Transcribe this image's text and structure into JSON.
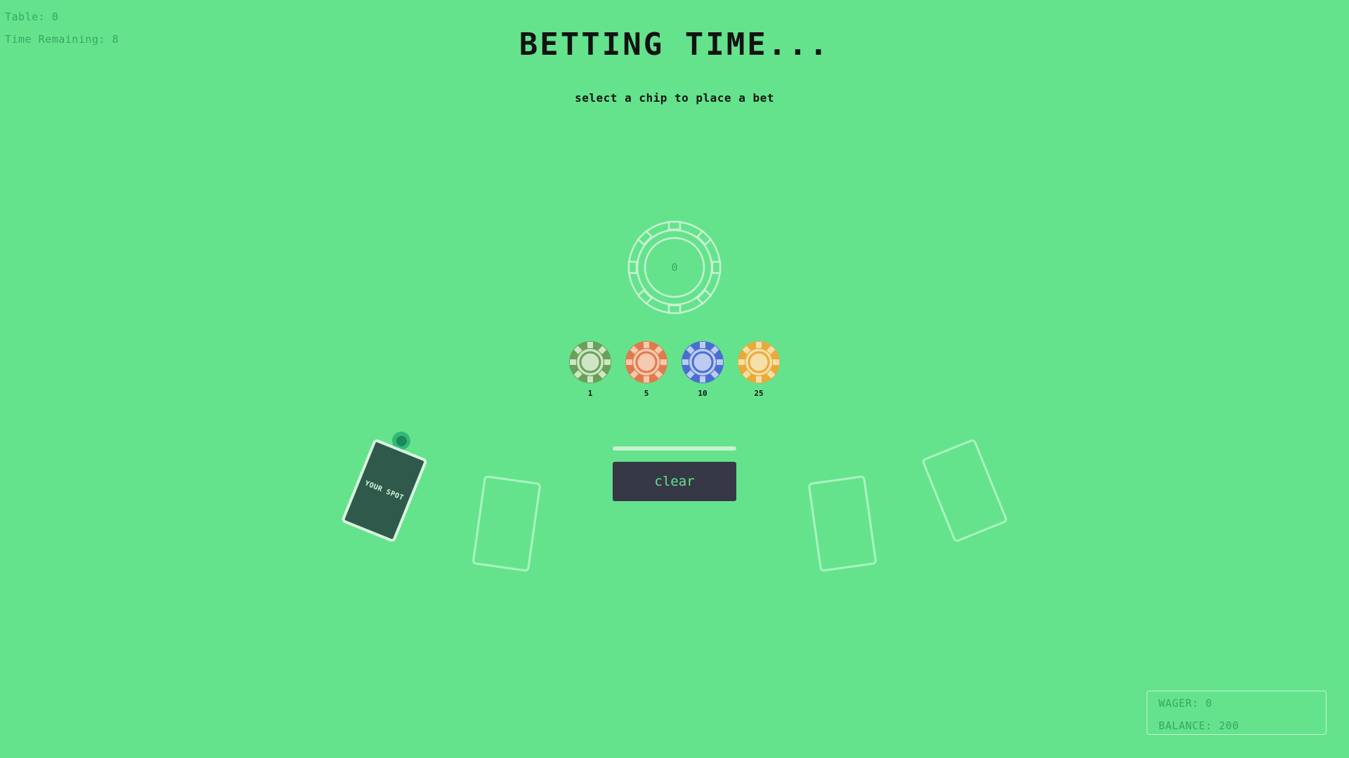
{
  "hud": {
    "table": "Table: 0",
    "time_remaining": "Time Remaining: 8"
  },
  "header": {
    "title": "BETTING TIME...",
    "subtitle": "select a chip to place a bet"
  },
  "bet": {
    "amount": "0"
  },
  "chips": [
    {
      "label": "1",
      "color": "#6aa05a",
      "light": "#cfe6c4",
      "icon": "green-chip-icon"
    },
    {
      "label": "5",
      "color": "#e07a4a",
      "light": "#f6c9b0",
      "icon": "orange-chip-icon"
    },
    {
      "label": "10",
      "color": "#4a6fd0",
      "light": "#bccbf2",
      "icon": "blue-chip-icon"
    },
    {
      "label": "25",
      "color": "#e8aa3a",
      "light": "#f7dfa8",
      "icon": "gold-chip-icon"
    }
  ],
  "seats": {
    "your_spot": "YOUR SPOT"
  },
  "controls": {
    "clear_label": "clear"
  },
  "wallet": {
    "wager": "WAGER: 0",
    "balance": "BALANCE: 200"
  },
  "colors": {
    "felt": "#64e38c",
    "button_bg": "#363845",
    "your_spot_bg": "#2f5a4b"
  }
}
